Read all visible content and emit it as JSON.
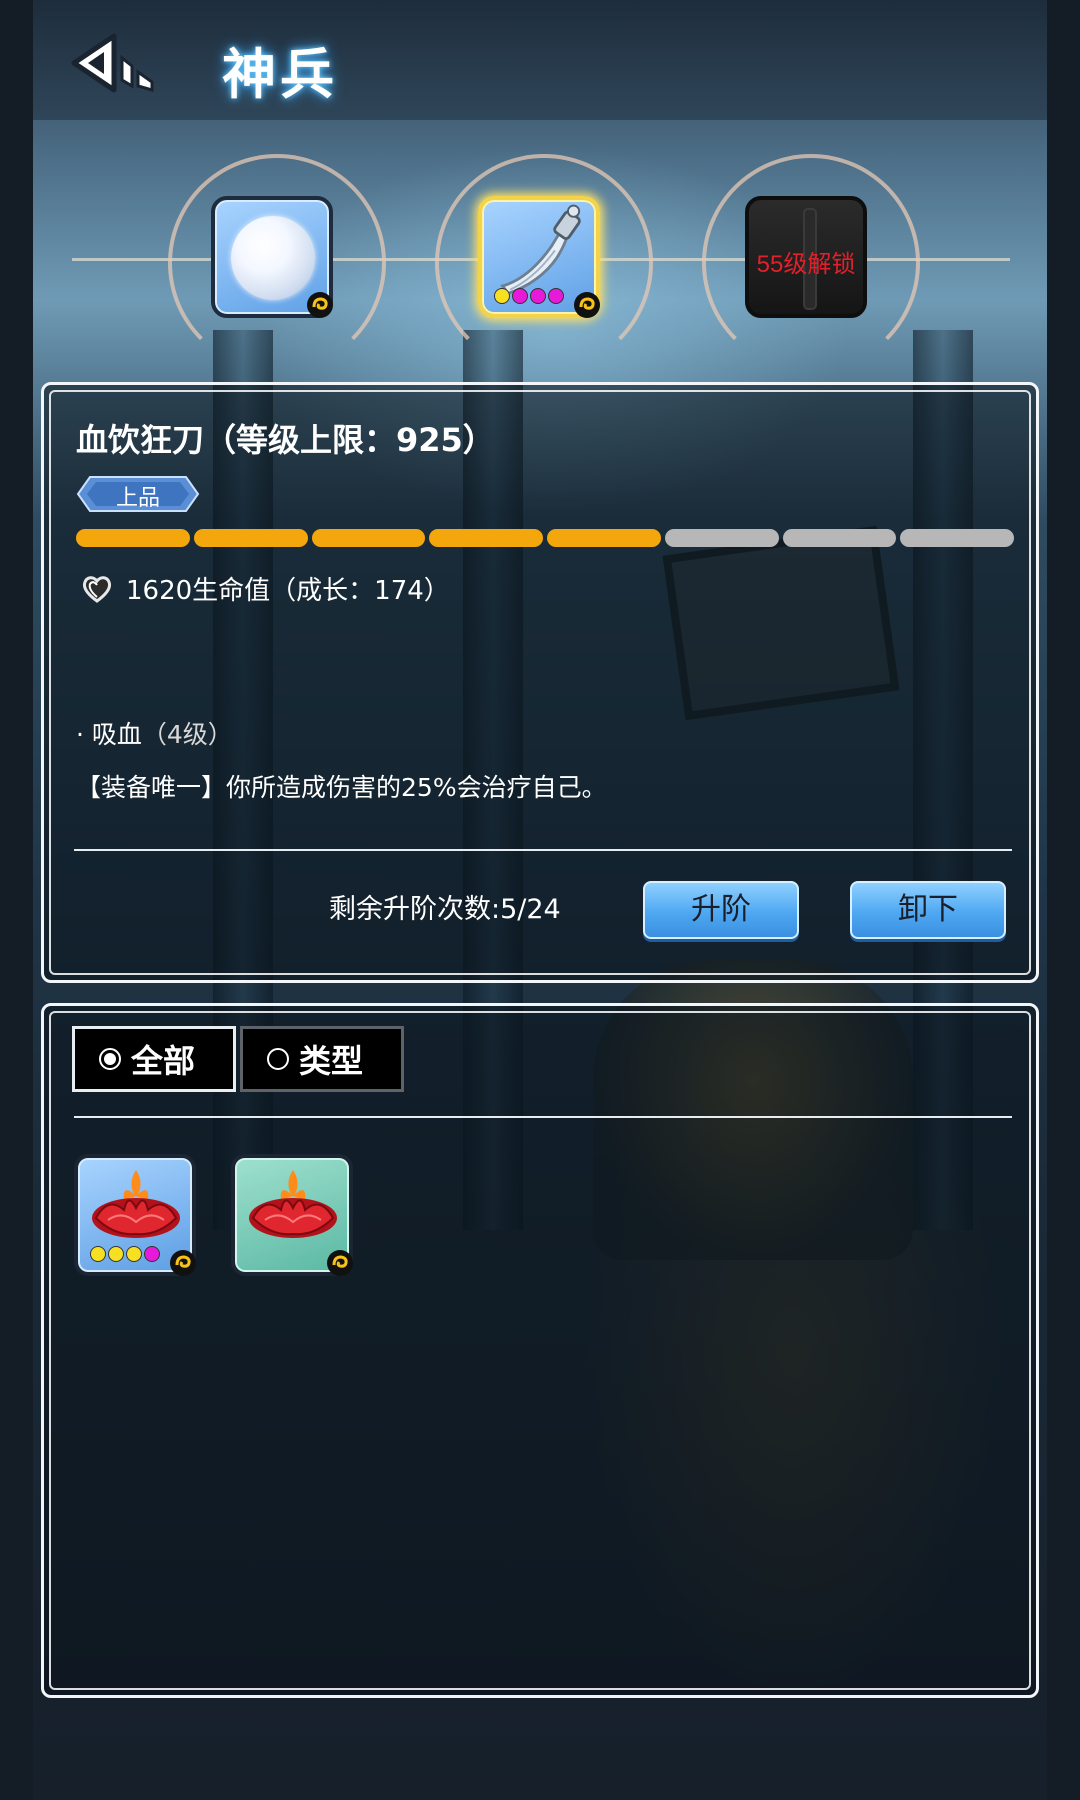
{
  "header": {
    "title": "神兵"
  },
  "slots": {
    "slot1": {
      "type": "pearl"
    },
    "slot2": {
      "type": "blade",
      "selected": true,
      "quality_dots": [
        "#f7e021",
        "#e61ad8",
        "#e61ad8",
        "#e61ad8"
      ]
    },
    "slot3": {
      "locked_text": "55级解锁"
    }
  },
  "item": {
    "title": "血饮狂刀（等级上限：925）",
    "grade": "上品",
    "progress": {
      "filled": 5,
      "total": 8
    },
    "stat": "1620生命值（成长：174）",
    "skill_bullet": "· 吸血",
    "skill_level": "（4级）",
    "skill_desc": "【装备唯一】你所造成伤害的25%会治疗自己。"
  },
  "actions": {
    "remaining": "剩余升阶次数:5/24",
    "advance_label": "升阶",
    "unequip_label": "卸下"
  },
  "filters": {
    "all_label": "全部",
    "type_label": "类型",
    "selected": "all"
  },
  "inventory": [
    {
      "type": "lotus",
      "rarity_color": "#7fb8f0",
      "quality_dots": [
        "#f7e021",
        "#f7e021",
        "#f7e021",
        "#e61ad8"
      ]
    },
    {
      "type": "lotus",
      "rarity_color": "#7fd4c0",
      "quality_dots": []
    }
  ],
  "colors": {
    "progress_on": "#f4a70c",
    "progress_off": "#b7b7b7",
    "locked_text": "#e0212b",
    "button": "#4fa8f2"
  }
}
